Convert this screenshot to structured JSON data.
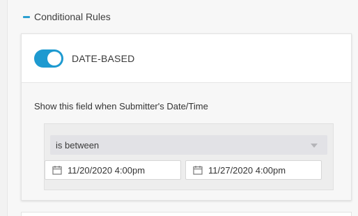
{
  "section": {
    "title": "Conditional Rules"
  },
  "card": {
    "title": "DATE-BASED",
    "toggle_on": true
  },
  "condition": {
    "text": "Show this field when Submitter's Date/Time",
    "operator": "is between",
    "start_date": "11/20/2020 4:00pm",
    "end_date": "11/27/2020 4:00pm"
  },
  "colors": {
    "accent": "#1e9ad0"
  }
}
